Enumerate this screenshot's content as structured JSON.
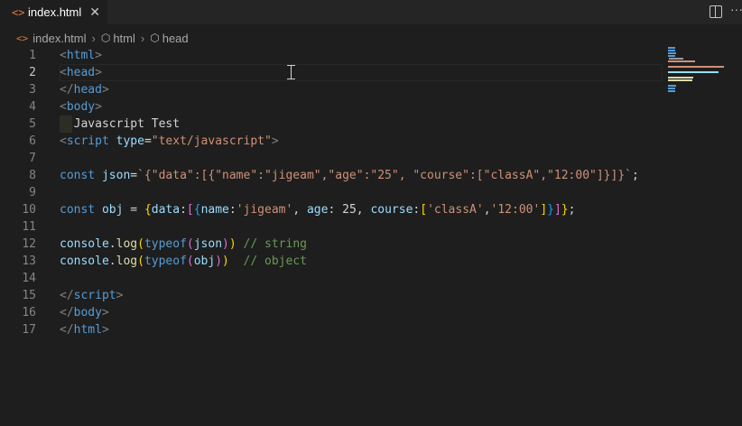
{
  "tab": {
    "title": "index.html",
    "icon": "html-file-icon",
    "close_symbol": "✕"
  },
  "actions": {
    "split_editor_icon": "split-editor-icon",
    "more_symbol": "···"
  },
  "breadcrumb": {
    "file": "index.html",
    "item1": "html",
    "item2": "head",
    "separator": "›"
  },
  "editor": {
    "active_line": 2,
    "line_numbers": [
      "1",
      "2",
      "3",
      "4",
      "5",
      "6",
      "7",
      "8",
      "9",
      "10",
      "11",
      "12",
      "13",
      "14",
      "15",
      "16",
      "17"
    ],
    "lines": {
      "l1": {
        "p1": "<",
        "p2": "html",
        "p3": ">"
      },
      "l2": {
        "p1": "<",
        "p2": "head",
        "p3": ">"
      },
      "l3": {
        "p1": "</",
        "p2": "head",
        "p3": ">"
      },
      "l4": {
        "p1": "<",
        "p2": "body",
        "p3": ">"
      },
      "l5": {
        "p1": "  Javascript Test"
      },
      "l6": {
        "p1": "<",
        "p2": "script",
        "p3": " ",
        "p4": "type",
        "p5": "=",
        "p6": "\"text/javascript\"",
        "p7": ">"
      },
      "l8": {
        "p1": "const",
        "p2": " ",
        "p3": "json",
        "p4": "=",
        "p5": "`{\"data\":[{\"name\":\"jigeam\",\"age\":\"25\", \"course\":[\"classA\",\"12:00\"]}]}`",
        "p6": ";"
      },
      "l10": {
        "p1": "const",
        "p2": " ",
        "p3": "obj",
        "p4": " = ",
        "p5": "{",
        "p6": "data",
        "p7": ":",
        "p8": "[",
        "p9": "{",
        "p10": "name",
        "p11": ":",
        "p12": "'jigeam'",
        "p13": ", ",
        "p14": "age",
        "p15": ": ",
        "p16": "25",
        "p17": ", ",
        "p18": "course",
        "p19": ":",
        "p20": "[",
        "p21": "'classA'",
        "p22": ",",
        "p23": "'12:00'",
        "p24": "]",
        "p25": "}",
        "p26": "]",
        "p27": "}",
        "p28": ";"
      },
      "l12": {
        "p1": "console",
        "p2": ".",
        "p3": "log",
        "p4": "(",
        "p5": "typeof",
        "p6": "(",
        "p7": "json",
        "p8": ")",
        "p9": ")",
        "p10": " ",
        "p11": "// string"
      },
      "l13": {
        "p1": "console",
        "p2": ".",
        "p3": "log",
        "p4": "(",
        "p5": "typeof",
        "p6": "(",
        "p7": "obj",
        "p8": ")",
        "p9": ")",
        "p10": "  ",
        "p11": "// object"
      },
      "l15": {
        "p1": "</",
        "p2": "script",
        "p3": ">"
      },
      "l16": {
        "p1": "</",
        "p2": "body",
        "p3": ">"
      },
      "l17": {
        "p1": "</",
        "p2": "html",
        "p3": ">"
      }
    }
  },
  "colors": {
    "background": "#1e1e1e",
    "tag": "#569cd6",
    "attribute": "#9cdcfe",
    "string": "#ce9178",
    "comment": "#6a9955",
    "function": "#dcdcaa",
    "bracket1": "#ffd700",
    "bracket2": "#da70d6",
    "bracket3": "#179fff"
  }
}
